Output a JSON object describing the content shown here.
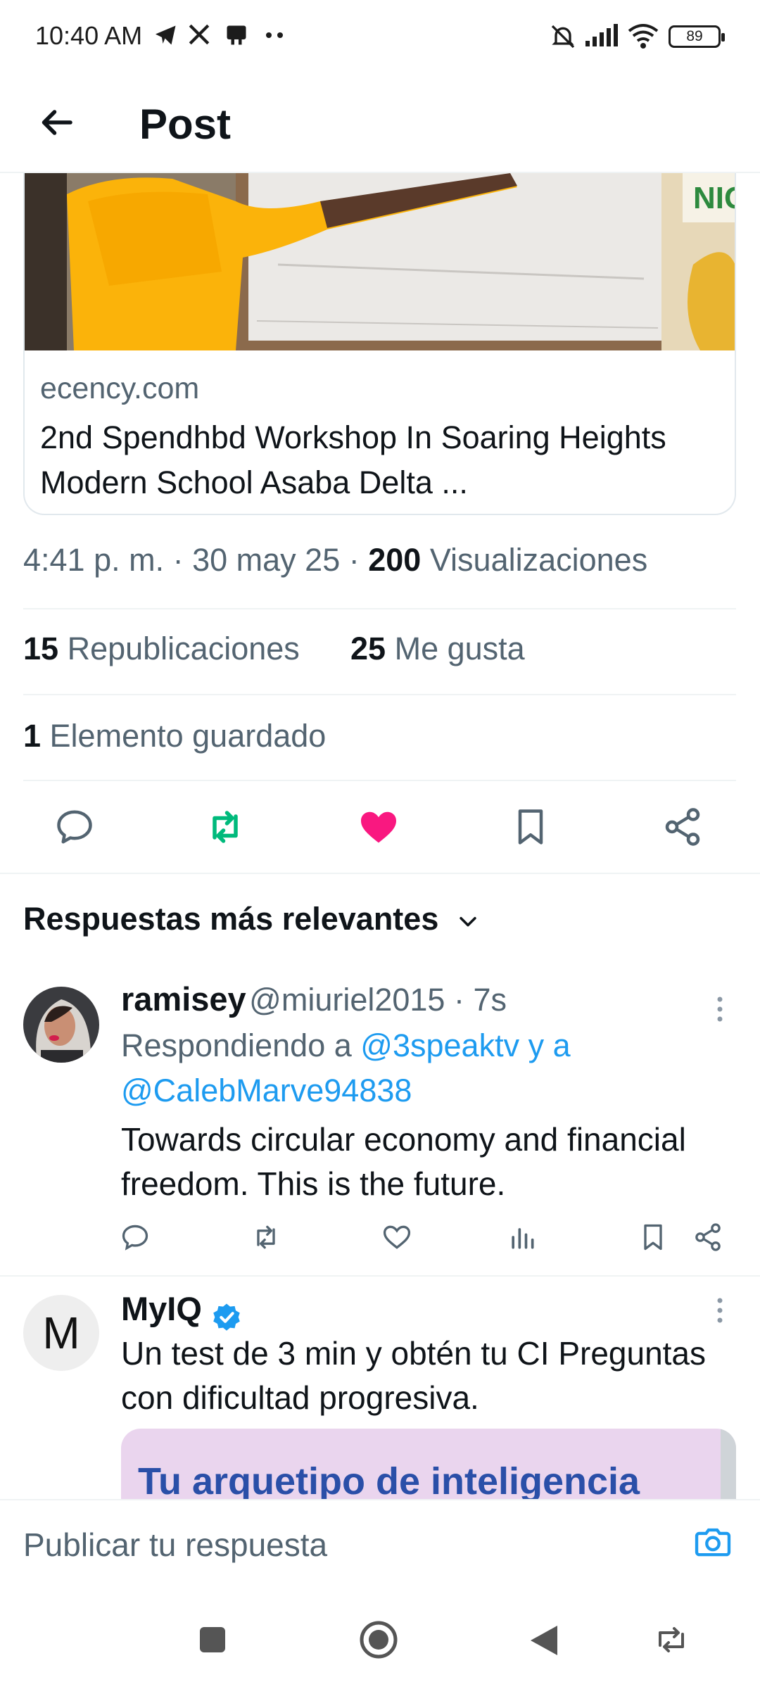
{
  "status_bar": {
    "time": "10:40 AM",
    "battery": "89"
  },
  "header": {
    "title": "Post"
  },
  "link_card": {
    "domain": "ecency.com",
    "title": "2nd Spendhbd Workshop In Soaring Heights Modern School Asaba Delta ..."
  },
  "post_meta": {
    "time": "4:41 p. m.",
    "date": "30 may 25",
    "views_count": "200",
    "views_label": "Visualizaciones"
  },
  "stats": {
    "reposts_count": "15",
    "reposts_label": "Republicaciones",
    "likes_count": "25",
    "likes_label": "Me gusta",
    "bookmarks_count": "1",
    "bookmarks_label": "Elemento guardado"
  },
  "replies_section": {
    "title": "Respuestas más relevantes"
  },
  "reply1": {
    "name": "ramisey",
    "handle": "@miuriel2015 · 7s",
    "replying_prefix": "Respondiendo a ",
    "mention1": "@3speaktv",
    "mention_joiner": " y a",
    "mention2": "@CalebMarve94838",
    "text": "Towards circular economy and financial freedom. This is the future."
  },
  "ad": {
    "avatar_letter": "M",
    "name": "MyIQ",
    "text": "Un test de 3 min y obtén tu CI Preguntas con dificultad progresiva.",
    "card_text": "Tu arquetipo de inteligencia"
  },
  "reply_bar": {
    "placeholder": "Publicar tu respuesta"
  },
  "colors": {
    "like": "#f91880",
    "repost": "#00ba7c",
    "link": "#1d9bf0",
    "verified": "#1d9bf0"
  }
}
